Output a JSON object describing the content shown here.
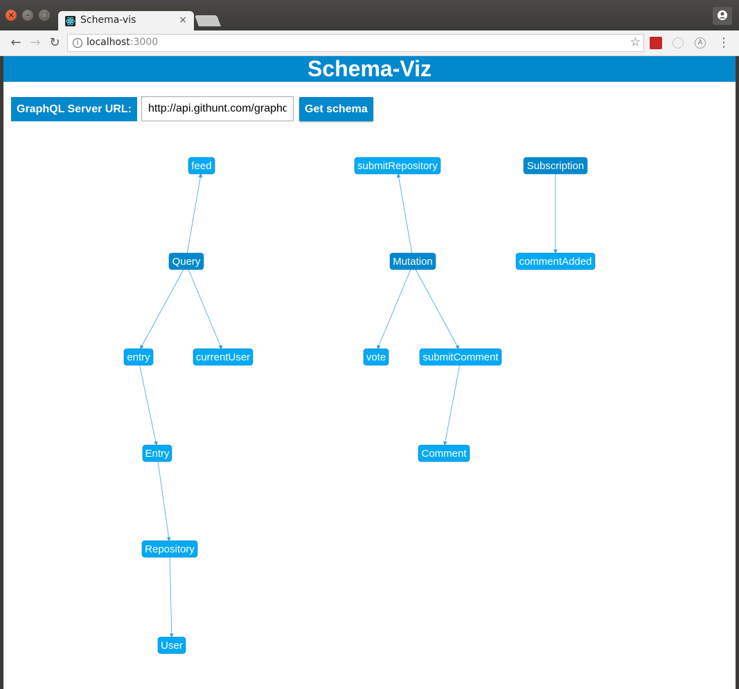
{
  "browser": {
    "tab_title": "Schema-vis",
    "tab_close": "×",
    "url_host": "localhost",
    "url_port": ":3000"
  },
  "app": {
    "title": "Schema-Viz",
    "url_label": "GraphQL Server URL:",
    "url_value": "http://api.githunt.com/graphql",
    "get_button": "Get schema"
  },
  "colors": {
    "header": "#0288cc",
    "root_node": "#0288cc",
    "field_node": "#03a9f4",
    "edge": "#3aa4d4"
  },
  "graph": {
    "nodes": [
      {
        "id": "feed",
        "label": "feed",
        "kind": "field"
      },
      {
        "id": "submitRepository",
        "label": "submitRepository",
        "kind": "field"
      },
      {
        "id": "Subscription",
        "label": "Subscription",
        "kind": "root"
      },
      {
        "id": "Query",
        "label": "Query",
        "kind": "root"
      },
      {
        "id": "Mutation",
        "label": "Mutation",
        "kind": "root"
      },
      {
        "id": "commentAdded",
        "label": "commentAdded",
        "kind": "field"
      },
      {
        "id": "entry",
        "label": "entry",
        "kind": "field"
      },
      {
        "id": "currentUser",
        "label": "currentUser",
        "kind": "field"
      },
      {
        "id": "vote",
        "label": "vote",
        "kind": "field"
      },
      {
        "id": "submitComment",
        "label": "submitComment",
        "kind": "field"
      },
      {
        "id": "Entry",
        "label": "Entry",
        "kind": "field"
      },
      {
        "id": "Comment",
        "label": "Comment",
        "kind": "field"
      },
      {
        "id": "Repository",
        "label": "Repository",
        "kind": "field"
      },
      {
        "id": "User",
        "label": "User",
        "kind": "field"
      }
    ],
    "edges": [
      {
        "from": "Query",
        "to": "feed"
      },
      {
        "from": "Query",
        "to": "entry"
      },
      {
        "from": "Query",
        "to": "currentUser"
      },
      {
        "from": "Mutation",
        "to": "submitRepository"
      },
      {
        "from": "Mutation",
        "to": "vote"
      },
      {
        "from": "Mutation",
        "to": "submitComment"
      },
      {
        "from": "Subscription",
        "to": "commentAdded"
      },
      {
        "from": "entry",
        "to": "Entry"
      },
      {
        "from": "Entry",
        "to": "Repository"
      },
      {
        "from": "Repository",
        "to": "User"
      },
      {
        "from": "submitComment",
        "to": "Comment"
      }
    ]
  }
}
